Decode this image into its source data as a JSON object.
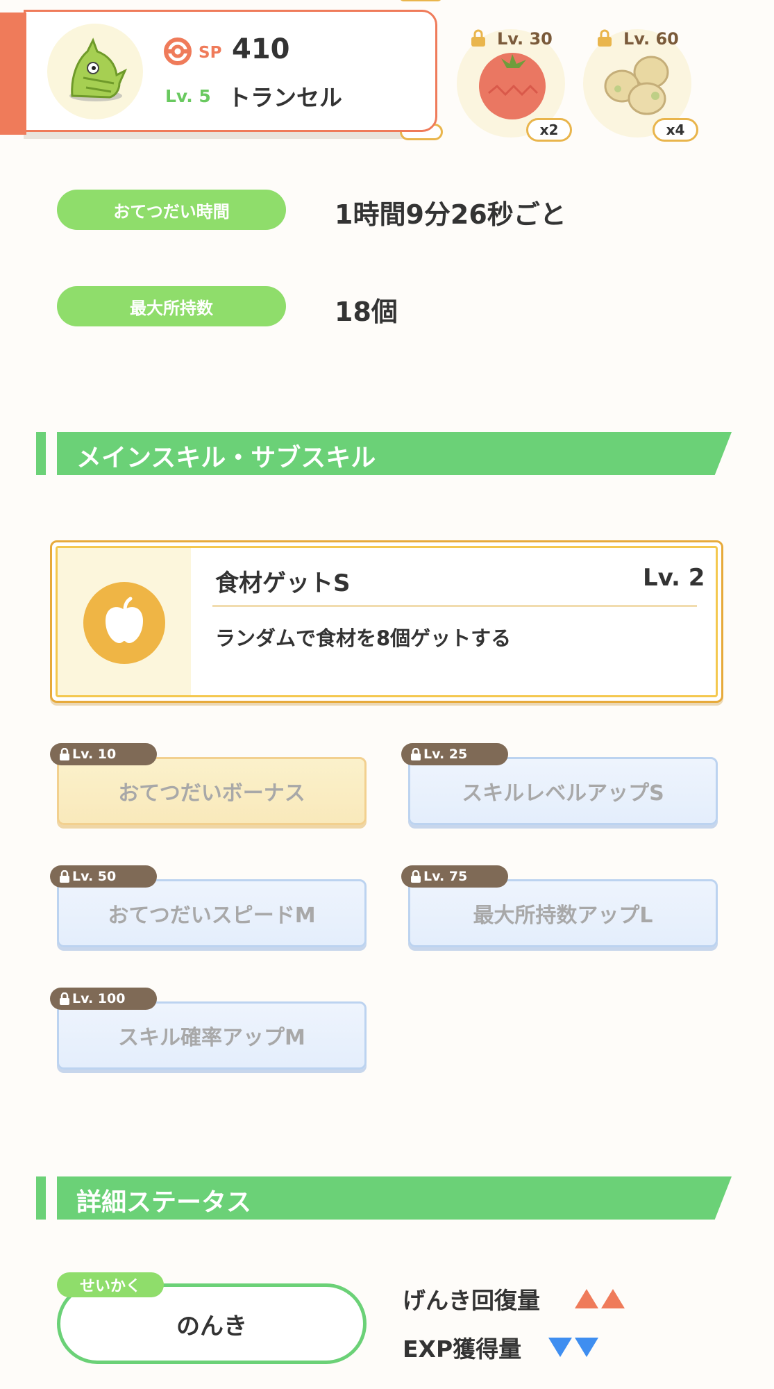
{
  "pokemon": {
    "sp_label": "SP",
    "sp_value": "410",
    "level": "Lv. 5",
    "name": "トランセル"
  },
  "ingredients": [
    {
      "unlock_level": "Lv. 30",
      "count": "x2",
      "icon": "tomato-icon"
    },
    {
      "unlock_level": "Lv. 60",
      "count": "x4",
      "icon": "potato-icon"
    }
  ],
  "help": {
    "time_label": "おてつだい時間",
    "time_value": "1時間9分26秒ごと",
    "max_label": "最大所持数",
    "max_value": "18個"
  },
  "skills_section": {
    "title": "メインスキル・サブスキル"
  },
  "main_skill": {
    "name": "食材ゲットS",
    "level": "Lv. 2",
    "description": "ランダムで食材を8個ゲットする",
    "icon": "apple-icon"
  },
  "sub_skills": [
    {
      "unlock_level": "Lv. 10",
      "name": "おてつだいボーナス",
      "style": "gold"
    },
    {
      "unlock_level": "Lv. 25",
      "name": "スキルレベルアップS",
      "style": "blue"
    },
    {
      "unlock_level": "Lv. 50",
      "name": "おてつだいスピードM",
      "style": "blue"
    },
    {
      "unlock_level": "Lv. 75",
      "name": "最大所持数アップL",
      "style": "blue"
    },
    {
      "unlock_level": "Lv. 100",
      "name": "スキル確率アップM",
      "style": "blue"
    }
  ],
  "status_section": {
    "title": "詳細ステータス"
  },
  "nature": {
    "tag": "せいかく",
    "name": "のんき",
    "up_label": "げんき回復量",
    "down_label": "EXP獲得量",
    "up_color": "#ef7b5a",
    "down_color": "#3f8ef0"
  }
}
